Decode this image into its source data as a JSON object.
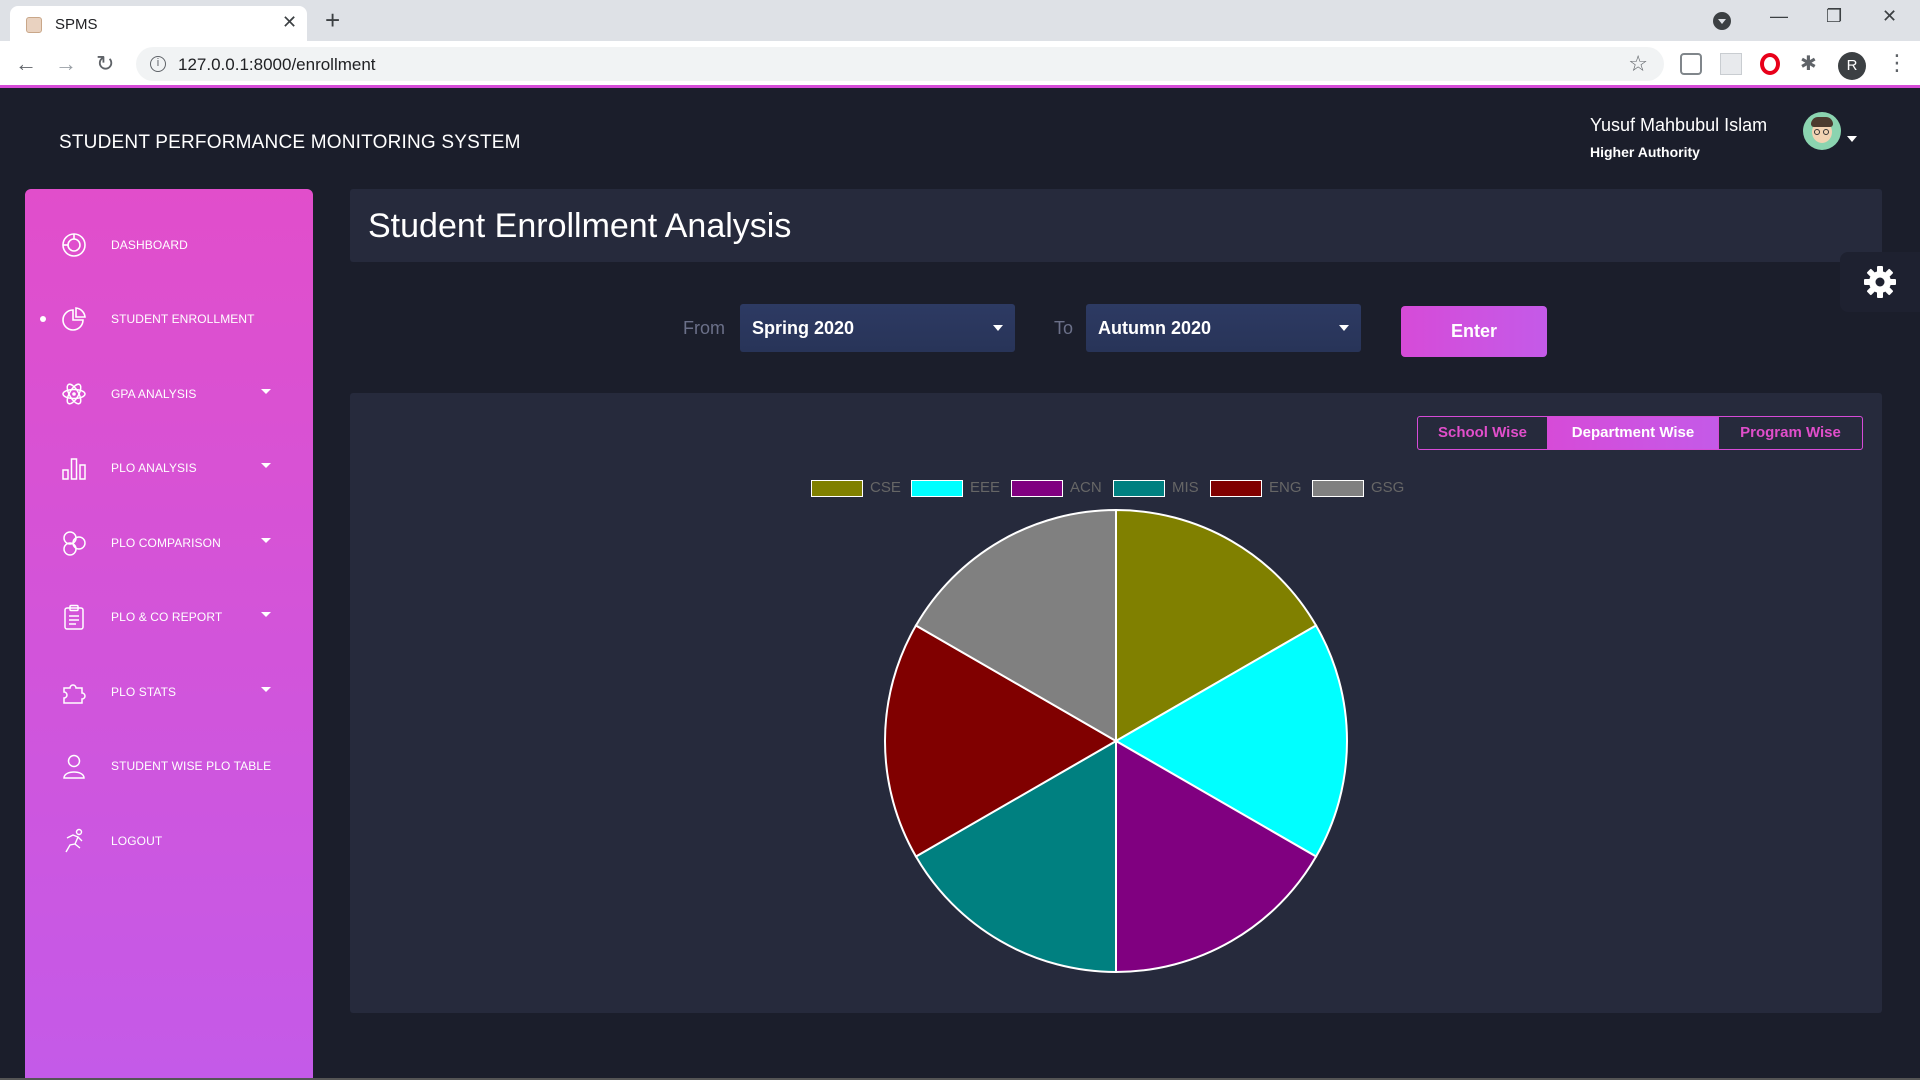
{
  "browser": {
    "tab_title": "SPMS",
    "url": "127.0.0.1:8000/enrollment",
    "profile_initial": "R"
  },
  "app": {
    "title": "STUDENT PERFORMANCE MONITORING SYSTEM",
    "user_name": "Yusuf Mahbubul Islam",
    "user_role": "Higher Authority"
  },
  "sidebar": {
    "items": [
      {
        "label": "DASHBOARD",
        "icon": "dashboard-icon",
        "has_caret": false,
        "active": false
      },
      {
        "label": "STUDENT ENROLLMENT",
        "icon": "pie-chart-icon",
        "has_caret": false,
        "active": true
      },
      {
        "label": "GPA ANALYSIS",
        "icon": "atom-icon",
        "has_caret": true,
        "active": false
      },
      {
        "label": "PLO ANALYSIS",
        "icon": "bar-chart-icon",
        "has_caret": true,
        "active": false
      },
      {
        "label": "PLO COMPARISON",
        "icon": "circles-icon",
        "has_caret": true,
        "active": false
      },
      {
        "label": "PLO & CO REPORT",
        "icon": "clipboard-icon",
        "has_caret": true,
        "active": false
      },
      {
        "label": "PLO STATS",
        "icon": "puzzle-icon",
        "has_caret": true,
        "active": false
      },
      {
        "label": "STUDENT WISE PLO TABLE",
        "icon": "user-icon",
        "has_caret": false,
        "active": false
      },
      {
        "label": "LOGOUT",
        "icon": "runner-icon",
        "has_caret": false,
        "active": false
      }
    ]
  },
  "main": {
    "page_title": "Student Enrollment Analysis",
    "filters": {
      "from_label": "From",
      "from_value": "Spring 2020",
      "to_label": "To",
      "to_value": "Autumn 2020",
      "enter_label": "Enter"
    },
    "view_toggle": {
      "school": "School Wise",
      "department": "Department Wise",
      "program": "Program Wise",
      "selected": "Department Wise"
    }
  },
  "colors": {
    "accent": "#d64bd8",
    "panel": "#262a3c",
    "background": "#1b1e2b"
  },
  "chart_data": {
    "type": "pie",
    "title": "",
    "legend_placement": "top",
    "categories": [
      "CSE",
      "EEE",
      "ACN",
      "MIS",
      "ENG",
      "GSG"
    ],
    "values": [
      1,
      1,
      1,
      1,
      1,
      1
    ],
    "colors": [
      "#808000",
      "#00ffff",
      "#800080",
      "#008080",
      "#800000",
      "#808080"
    ]
  }
}
